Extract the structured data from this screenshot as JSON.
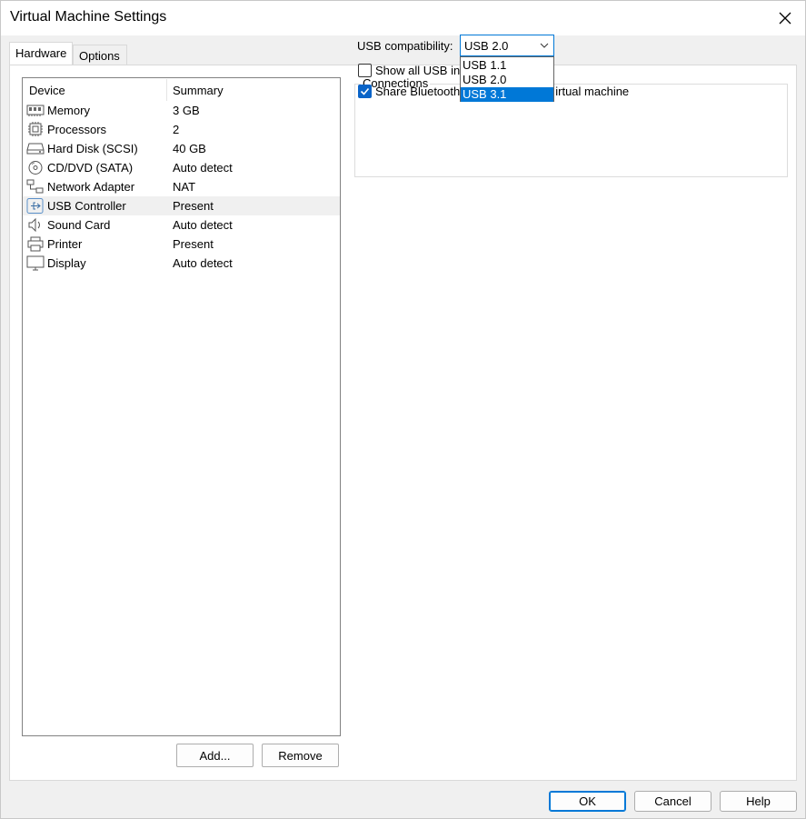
{
  "window": {
    "title": "Virtual Machine Settings"
  },
  "tabs": [
    {
      "label": "Hardware",
      "active": true
    },
    {
      "label": "Options",
      "active": false
    }
  ],
  "device_list": {
    "columns": [
      "Device",
      "Summary"
    ],
    "rows": [
      {
        "device": "Memory",
        "summary": "3 GB",
        "icon": "memory-icon"
      },
      {
        "device": "Processors",
        "summary": "2",
        "icon": "processor-icon"
      },
      {
        "device": "Hard Disk (SCSI)",
        "summary": "40 GB",
        "icon": "hard-disk-icon"
      },
      {
        "device": "CD/DVD (SATA)",
        "summary": "Auto detect",
        "icon": "cd-dvd-icon"
      },
      {
        "device": "Network Adapter",
        "summary": "NAT",
        "icon": "network-adapter-icon"
      },
      {
        "device": "USB Controller",
        "summary": "Present",
        "icon": "usb-icon",
        "selected": true
      },
      {
        "device": "Sound Card",
        "summary": "Auto detect",
        "icon": "speaker-icon"
      },
      {
        "device": "Printer",
        "summary": "Present",
        "icon": "printer-icon"
      },
      {
        "device": "Display",
        "summary": "Auto detect",
        "icon": "monitor-icon"
      }
    ],
    "add_label": "Add...",
    "remove_label": "Remove"
  },
  "connections": {
    "legend": "Connections",
    "usb_compat_label": "USB compatibility:",
    "usb_compat_value": "USB 2.0",
    "options": [
      "USB 1.1",
      "USB 2.0",
      "USB 3.1"
    ],
    "highlighted_option": "USB 3.1",
    "show_all_usb_label_visible": "Show all USB inp",
    "show_all_usb_checked": false,
    "share_bt_left": "Share Bluetooth",
    "share_bt_right": "irtual machine",
    "share_bt_checked": true
  },
  "footer": {
    "ok": "OK",
    "cancel": "Cancel",
    "help": "Help"
  },
  "colors": {
    "accent": "#0078d7",
    "checkbox_on": "#0a64c8"
  }
}
